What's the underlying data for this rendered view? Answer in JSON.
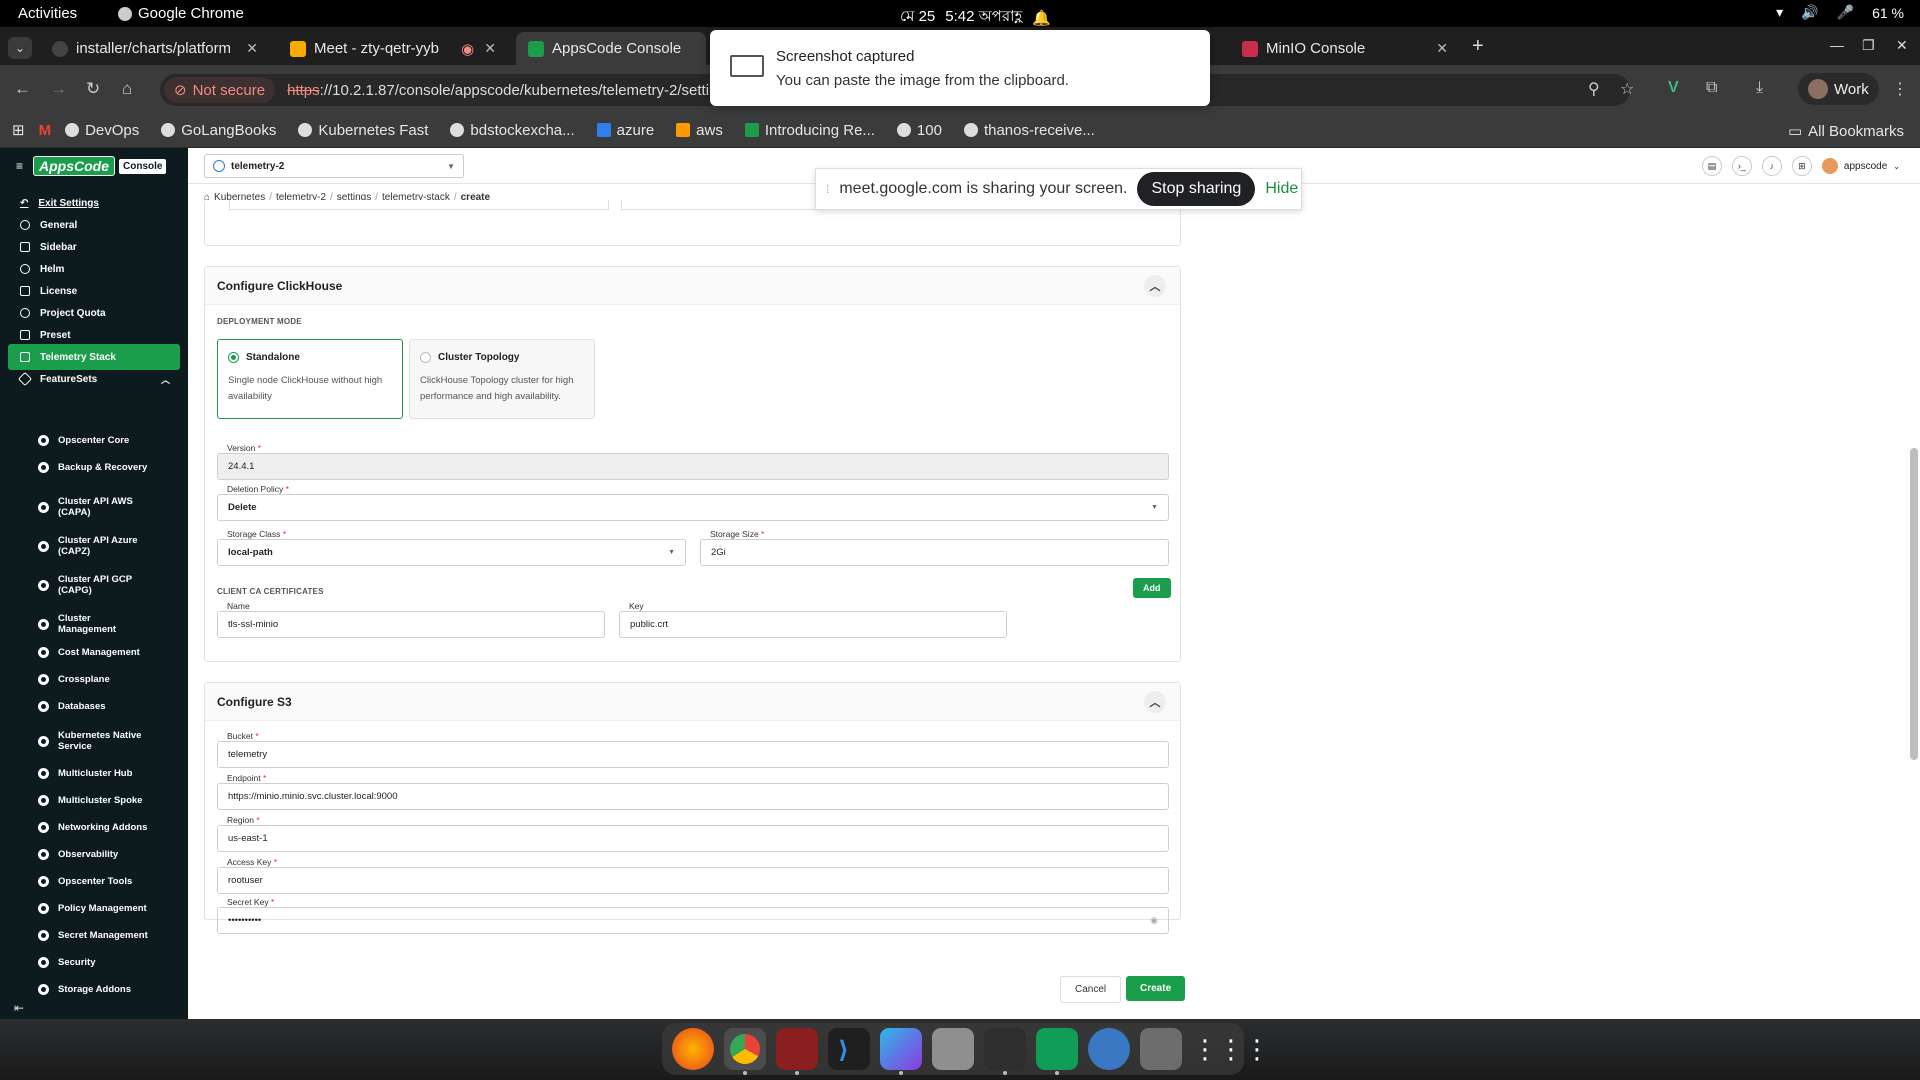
{
  "os": {
    "activities": "Activities",
    "app_name": "Google Chrome",
    "clock_date": "মে 25",
    "clock_time": "5:42 অপরাহ্ণ",
    "battery": "61 %"
  },
  "tabs": [
    {
      "label": "installer/charts/platform",
      "active": false
    },
    {
      "label": "Meet - zty-qetr-yyb",
      "active": false
    },
    {
      "label": "AppsCode Console",
      "active": true
    },
    {
      "label": "MinIO Console",
      "active": false
    }
  ],
  "omnibox": {
    "not_secure": "Not secure",
    "url_scheme": "https",
    "url_rest": "://10.2.1.87/console/appscode/kubernetes/telemetry-2/settings"
  },
  "profile": {
    "label": "Work"
  },
  "bookmarks": [
    {
      "label": "DevOps",
      "icon": "github-icon"
    },
    {
      "label": "GoLangBooks",
      "icon": "github-icon"
    },
    {
      "label": "Kubernetes Fast",
      "icon": "github-icon"
    },
    {
      "label": "bdstockexcha...",
      "icon": "github-icon"
    },
    {
      "label": "azure",
      "icon": "azure-icon"
    },
    {
      "label": "aws",
      "icon": "aws-icon"
    },
    {
      "label": "Introducing Re...",
      "icon": "appscode-icon"
    },
    {
      "label": "100",
      "icon": "github-icon"
    },
    {
      "label": "thanos-receive...",
      "icon": "github-icon"
    }
  ],
  "all_bookmarks": "All Bookmarks",
  "toast": {
    "title": "Screenshot captured",
    "body": "You can paste the image from the clipboard."
  },
  "share": {
    "message": "meet.google.com is sharing your screen.",
    "stop": "Stop sharing",
    "hide": "Hide"
  },
  "app": {
    "logo_text": "AppsCode",
    "console_badge": "Console",
    "context": "telemetry-2",
    "user": "appscode"
  },
  "sidebar": {
    "exit": "Exit Settings",
    "items": [
      {
        "label": "General",
        "icon": "gear-icon"
      },
      {
        "label": "Sidebar",
        "icon": "sidebar-icon"
      },
      {
        "label": "Helm",
        "icon": "helm-icon"
      },
      {
        "label": "License",
        "icon": "license-icon"
      },
      {
        "label": "Project Quota",
        "icon": "quota-icon"
      },
      {
        "label": "Preset",
        "icon": "sliders-icon"
      },
      {
        "label": "Telemetry Stack",
        "icon": "telemetry-icon",
        "active": true
      },
      {
        "label": "FeatureSets",
        "icon": "featuresets-icon"
      }
    ],
    "featuresets": [
      "Opscenter Core",
      "Backup & Recovery",
      "Cluster API AWS (CAPA)",
      "Cluster API Azure (CAPZ)",
      "Cluster API GCP (CAPG)",
      "Cluster Management",
      "Cost Management",
      "Crossplane",
      "Databases",
      "Kubernetes Native Service",
      "Multicluster Hub",
      "Multicluster Spoke",
      "Networking Addons",
      "Observability",
      "Opscenter Tools",
      "Policy Management",
      "Secret Management",
      "Security",
      "Storage Addons"
    ]
  },
  "breadcrumb": [
    "Kubernetes",
    "telemetry-2",
    "settings",
    "telemetry-stack",
    "create"
  ],
  "clickhouse": {
    "title": "Configure ClickHouse",
    "deployment_mode_label": "DEPLOYMENT MODE",
    "modes": [
      {
        "title": "Standalone",
        "desc": "Single node ClickHouse without high availability",
        "selected": true
      },
      {
        "title": "Cluster Topology",
        "desc": "ClickHouse Topology cluster for high performance and high availability.",
        "selected": false
      }
    ],
    "version": {
      "label": "Version",
      "value": "24.4.1"
    },
    "deletion_policy": {
      "label": "Deletion Policy",
      "value": "Delete"
    },
    "storage_class": {
      "label": "Storage Class",
      "value": "local-path"
    },
    "storage_size": {
      "label": "Storage Size",
      "value": "2Gi"
    },
    "client_ca_label": "CLIENT CA CERTIFICATES",
    "add_button": "Add",
    "name": {
      "label": "Name",
      "value": "tls-ssl-minio"
    },
    "key": {
      "label": "Key",
      "value": "public.crt"
    }
  },
  "s3": {
    "title": "Configure S3",
    "bucket": {
      "label": "Bucket",
      "value": "telemetry"
    },
    "endpoint": {
      "label": "Endpoint",
      "value": "https://minio.minio.svc.cluster.local:9000"
    },
    "region": {
      "label": "Region",
      "value": "us-east-1"
    },
    "access_key": {
      "label": "Access Key",
      "value": "rootuser"
    },
    "secret_key": {
      "label": "Secret Key",
      "value": "••••••••••"
    }
  },
  "actions": {
    "cancel": "Cancel",
    "create": "Create"
  },
  "colors": {
    "brand": "#1b9e4b",
    "sidebar": "#0d1b1f"
  },
  "dock": [
    "firefox-icon",
    "chrome-icon",
    "terminal-icon",
    "vscode-icon",
    "goland-icon",
    "files-icon",
    "system-monitor-icon",
    "chat-icon",
    "qbittorrent-icon",
    "trash-icon",
    "apps-grid-icon"
  ]
}
